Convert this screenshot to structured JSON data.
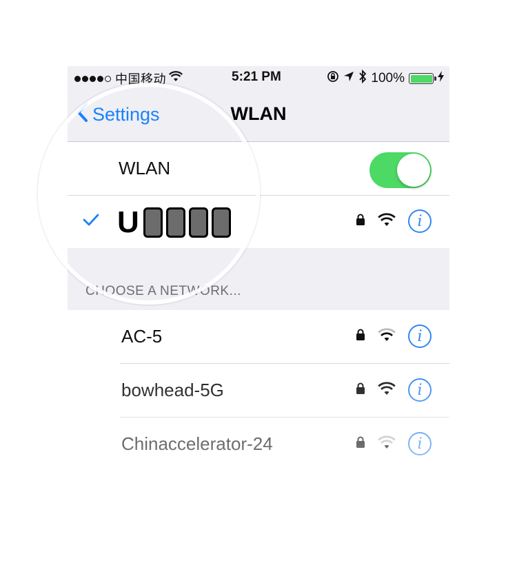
{
  "status_bar": {
    "carrier": "中国移动",
    "time": "5:21 PM",
    "battery": "100%",
    "icons": [
      "signal-dots-icon",
      "wifi-icon",
      "rotation-lock-icon",
      "location-icon",
      "bluetooth-icon",
      "battery-icon",
      "charging-icon"
    ]
  },
  "nav": {
    "back_label": "Settings",
    "title": "WLAN"
  },
  "wlan_toggle": {
    "label": "WLAN",
    "on": true
  },
  "current_network": {
    "ssid_prefix": "U",
    "connected": true
  },
  "section_header": "CHOOSE A NETWORK...",
  "networks": [
    {
      "name": "AC-5",
      "secured": true
    },
    {
      "name": "bowhead-5G",
      "secured": true
    },
    {
      "name": "Chinaccelerator-24",
      "secured": true
    }
  ],
  "colors": {
    "accent": "#1a82fb",
    "toggle_on": "#4cd964",
    "background": "#efeff4"
  }
}
